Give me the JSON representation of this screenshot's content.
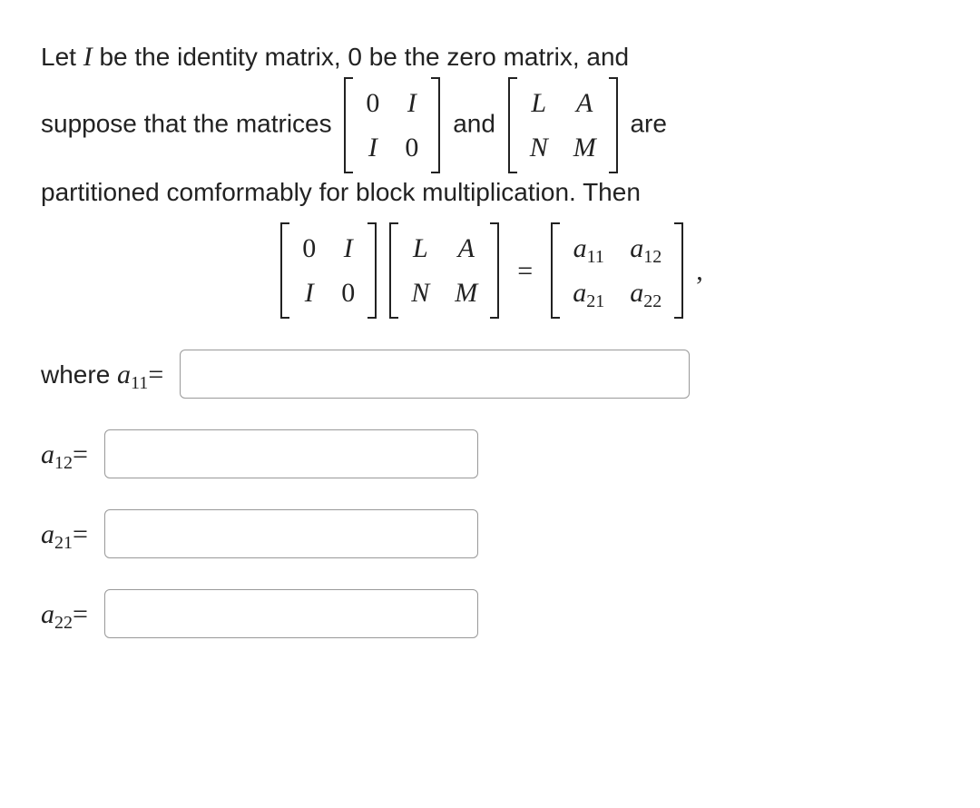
{
  "problem": {
    "line1_a": "Let ",
    "I": "I",
    "line1_b": " be the identity matrix, 0 be the zero matrix, and",
    "line2_a": "suppose that the matrices ",
    "line2_mid": " and ",
    "line2_b": " are",
    "line3": "partitioned comformably for block multiplication. Then",
    "mat1": {
      "r1c1": "0",
      "r1c2": "I",
      "r2c1": "I",
      "r2c2": "0"
    },
    "mat2": {
      "r1c1": "L",
      "r1c2": "A",
      "r2c1": "N",
      "r2c2": "M"
    },
    "resmat": {
      "r1c1": "a",
      "s11": "11",
      "r1c2": "a",
      "s12": "12",
      "r2c1": "a",
      "s21": "21",
      "r2c2": "a",
      "s22": "22"
    },
    "equals": "=",
    "comma": ","
  },
  "answers": {
    "where": "where ",
    "a_label": "a",
    "s11": "11",
    "s12": "12",
    "s21": "21",
    "s22": "22",
    "eq": " = ",
    "v11": "",
    "v12": "",
    "v21": "",
    "v22": ""
  }
}
